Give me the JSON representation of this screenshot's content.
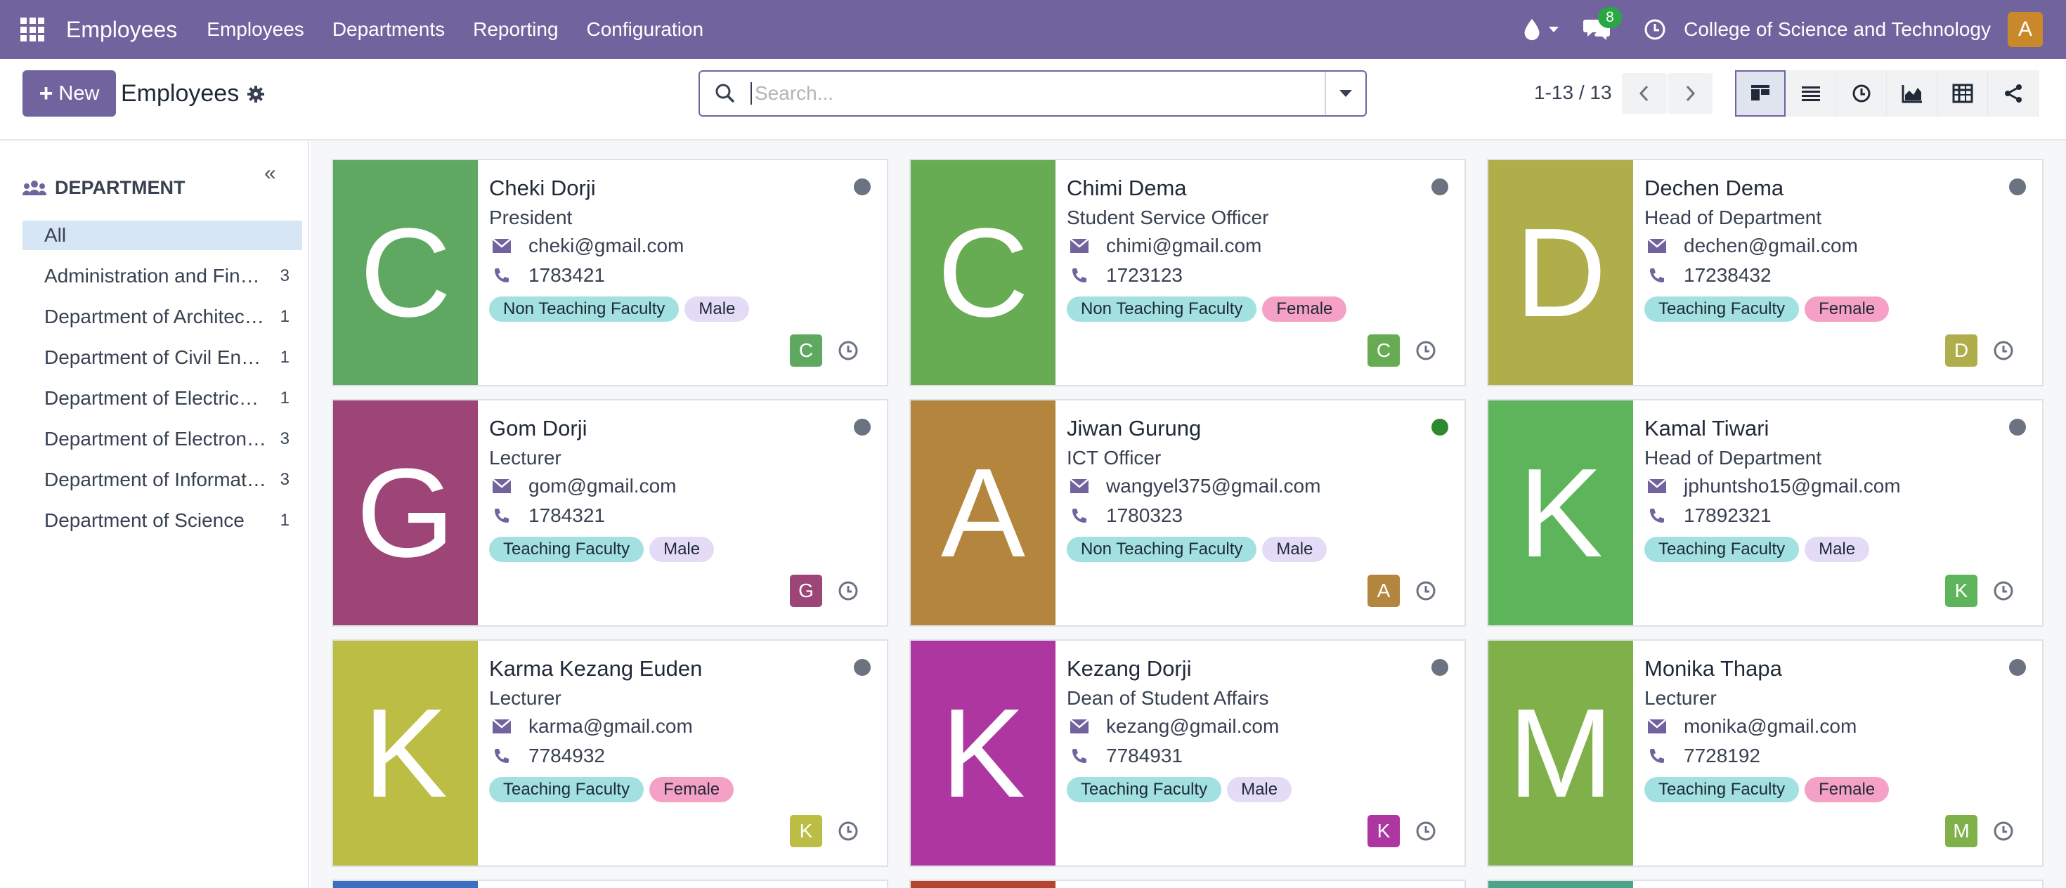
{
  "navbar": {
    "brand": "Employees",
    "menu": [
      "Employees",
      "Departments",
      "Reporting",
      "Configuration"
    ],
    "messages_count": "8",
    "company": "College of Science and Technology",
    "user_initial": "A"
  },
  "control": {
    "new_label": "New",
    "title": "Employees",
    "search_placeholder": "Search...",
    "pager": "1-13 / 13",
    "views": [
      "kanban-icon",
      "list-icon",
      "activity-icon",
      "graph-icon",
      "pivot-icon",
      "hierarchy-icon"
    ]
  },
  "sidebar": {
    "heading": "DEPARTMENT",
    "items": [
      {
        "label": "All",
        "count": ""
      },
      {
        "label": "Administration and Finance",
        "count": "3"
      },
      {
        "label": "Department of Architecture",
        "count": "1"
      },
      {
        "label": "Department of Civil Engineering",
        "count": "1"
      },
      {
        "label": "Department of Electrical Engineering",
        "count": "1"
      },
      {
        "label": "Department of Electronics",
        "count": "3"
      },
      {
        "label": "Department of Information Technology",
        "count": "3"
      },
      {
        "label": "Department of Science",
        "count": "1"
      }
    ]
  },
  "employees": [
    {
      "initial": "C",
      "name": "Cheki Dorji",
      "job": "President",
      "email": "cheki@gmail.com",
      "phone": "1783421",
      "tags": [
        "Non Teaching Faculty",
        "Male"
      ],
      "color": "#5fa862",
      "status": "offline"
    },
    {
      "initial": "C",
      "name": "Chimi Dema",
      "job": "Student Service Officer",
      "email": "chimi@gmail.com",
      "phone": "1723123",
      "tags": [
        "Non Teaching Faculty",
        "Female"
      ],
      "color": "#67ab52",
      "status": "offline"
    },
    {
      "initial": "D",
      "name": "Dechen Dema",
      "job": "Head of Department",
      "email": "dechen@gmail.com",
      "phone": "17238432",
      "tags": [
        "Teaching Faculty",
        "Female"
      ],
      "color": "#b0ad4b",
      "status": "offline"
    },
    {
      "initial": "G",
      "name": "Gom Dorji",
      "job": "Lecturer",
      "email": "gom@gmail.com",
      "phone": "1784321",
      "tags": [
        "Teaching Faculty",
        "Male"
      ],
      "color": "#9c4576",
      "status": "offline"
    },
    {
      "initial": "A",
      "name": "Jiwan Gurung",
      "job": "ICT Officer",
      "email": "wangyel375@gmail.com",
      "phone": "1780323",
      "tags": [
        "Non Teaching Faculty",
        "Male"
      ],
      "color": "#b3853d",
      "status": "online"
    },
    {
      "initial": "K",
      "name": "Kamal Tiwari",
      "job": "Head of Department",
      "email": "jphuntsho15@gmail.com",
      "phone": "17892321",
      "tags": [
        "Teaching Faculty",
        "Male"
      ],
      "color": "#5eb45b",
      "status": "offline"
    },
    {
      "initial": "K",
      "name": "Karma Kezang Euden",
      "job": "Lecturer",
      "email": "karma@gmail.com",
      "phone": "7784932",
      "tags": [
        "Teaching Faculty",
        "Female"
      ],
      "color": "#bcbd45",
      "status": "offline"
    },
    {
      "initial": "K",
      "name": "Kezang Dorji",
      "job": "Dean of Student Affairs",
      "email": "kezang@gmail.com",
      "phone": "7784931",
      "tags": [
        "Teaching Faculty",
        "Male"
      ],
      "color": "#ad36a1",
      "status": "offline"
    },
    {
      "initial": "M",
      "name": "Monika Thapa",
      "job": "Lecturer",
      "email": "monika@gmail.com",
      "phone": "7728192",
      "tags": [
        "Teaching Faculty",
        "Female"
      ],
      "color": "#80b04a",
      "status": "offline"
    }
  ],
  "partial_row_colors": [
    "#3b6fc4",
    "#b6452f",
    "#4aa38a"
  ]
}
